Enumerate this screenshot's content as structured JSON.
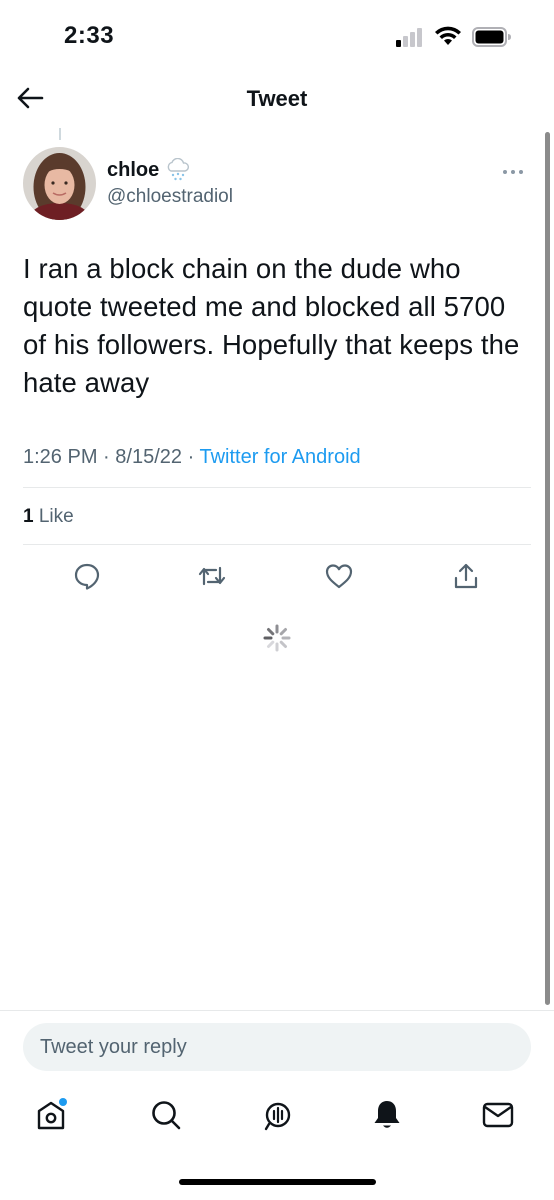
{
  "status_bar": {
    "time": "2:33",
    "icons": [
      "cellular-signal-icon",
      "wifi-icon",
      "battery-icon"
    ]
  },
  "nav": {
    "title": "Tweet",
    "back_icon": "arrow-left-icon"
  },
  "tweet": {
    "author": {
      "display_name": "chloe",
      "name_emoji": "cloud-with-snow-icon",
      "handle": "@chloestradiol"
    },
    "text": "I ran a block chain on the dude who quote tweeted me and blocked all 5700 of his followers. Hopefully that keeps the hate away",
    "time": "1:26 PM",
    "date": "8/15/22",
    "separator": "·",
    "source": "Twitter for Android",
    "like_count": "1",
    "like_label": "Like"
  },
  "actions": [
    "reply-icon",
    "retweet-icon",
    "like-icon",
    "share-icon"
  ],
  "reply": {
    "placeholder": "Tweet your reply"
  },
  "tab_bar": {
    "tabs": [
      "home-icon",
      "search-icon",
      "spaces-icon",
      "notifications-icon",
      "messages-icon"
    ],
    "home_has_badge": true
  },
  "colors": {
    "accent": "#1d9bf0",
    "text_primary": "#0f1419",
    "text_secondary": "#536471",
    "divider": "#e7e9ea",
    "reply_bg": "#eff3f4"
  }
}
